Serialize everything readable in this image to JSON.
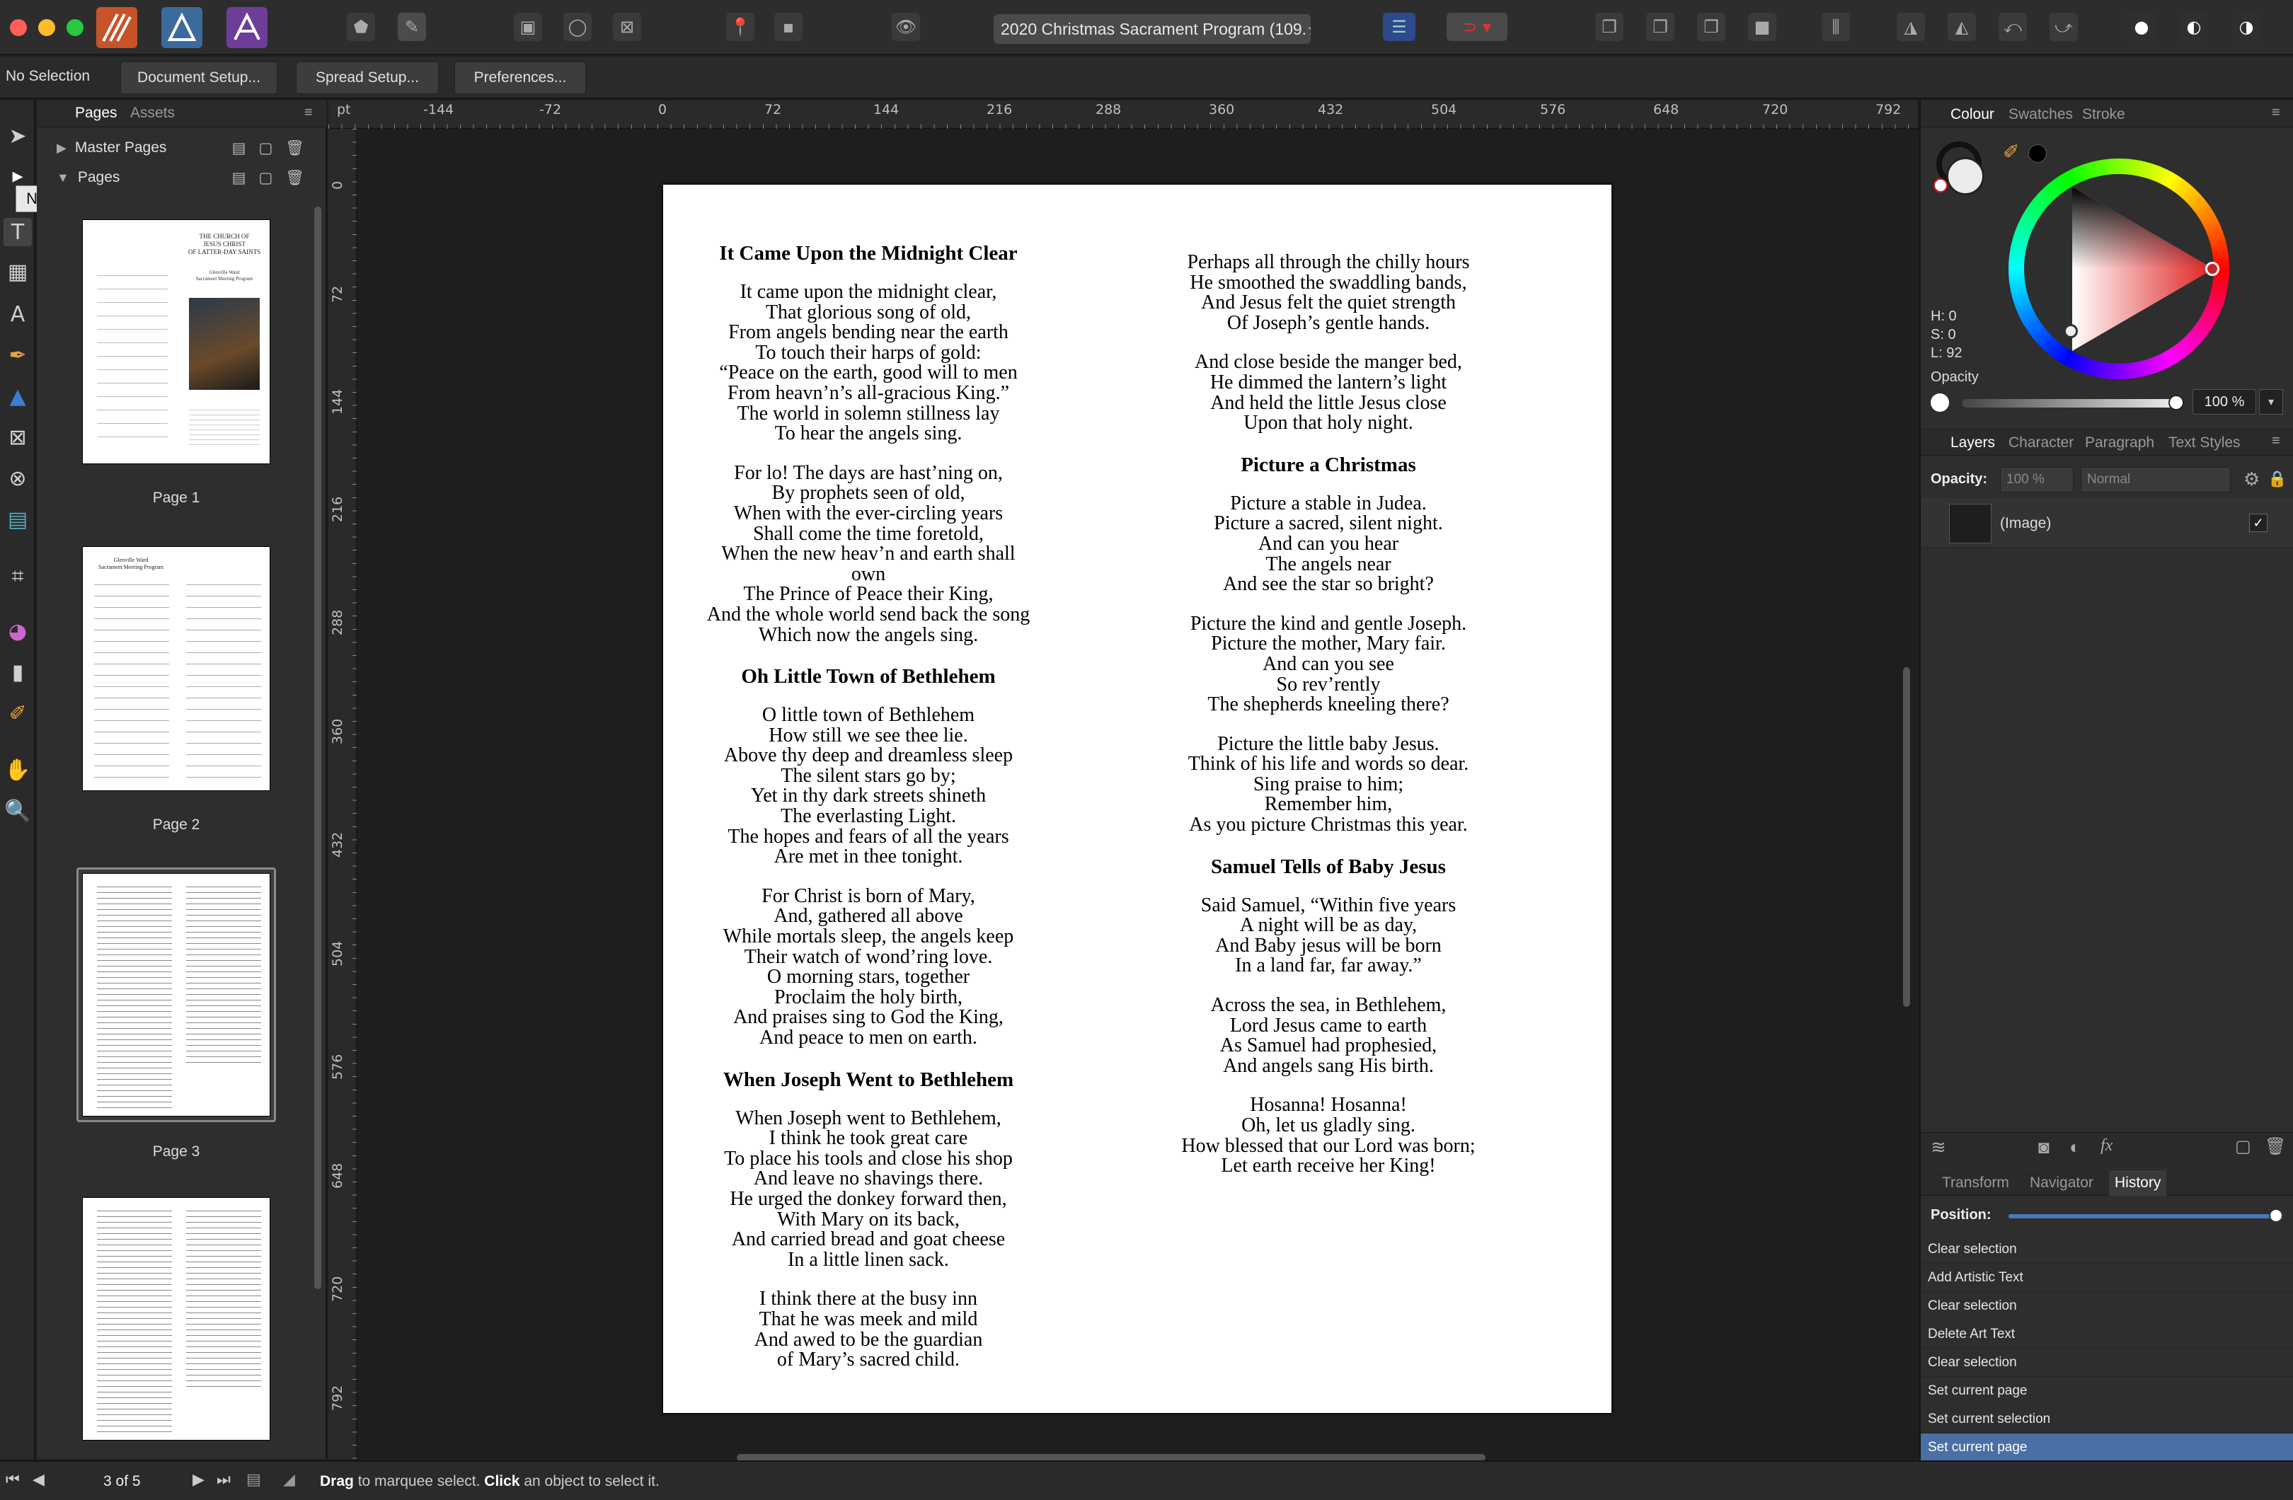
{
  "window": {
    "document_title": "2020 Christmas Sacrament Program (109.",
    "title_suffix_icon": "star-icon"
  },
  "context_bar": {
    "selection_label": "No Selection",
    "document_setup": "Document Setup...",
    "spread_setup": "Spread Setup...",
    "preferences": "Preferences..."
  },
  "tooltip": "Node Tool [A]",
  "left_panel": {
    "tabs": [
      "Pages",
      "Assets"
    ],
    "master_pages_label": "Master Pages",
    "pages_label": "Pages",
    "page_labels": [
      "Page 1",
      "Page 2",
      "Page 3"
    ],
    "thumb1_title": "THE CHURCH OF\nJESUS CHRIST\nOF LATTER-DAY SAINTS",
    "thumb1_sub": "Glenville Ward\nSacrament Meeting Program",
    "thumb2_title": "Glenville Ward\nSacrament Meeting Program"
  },
  "ruler": {
    "h_labels": [
      "pt",
      "-144",
      "-72",
      "0",
      "72",
      "144",
      "216",
      "288",
      "360",
      "432",
      "504",
      "576",
      "648",
      "720",
      "792"
    ],
    "v_labels": [
      "0",
      "72",
      "144",
      "216",
      "288",
      "360",
      "432",
      "504",
      "576",
      "648",
      "720",
      "792"
    ]
  },
  "document": {
    "left_column": [
      {
        "title": "It Came Upon the Midnight Clear",
        "verses": [
          "It came upon the midnight clear,\nThat glorious song of old,\nFrom angels bending near the earth\nTo touch their harps of gold:\n“Peace on the earth, good will to men\nFrom heavn’n’s all-gracious King.”\nThe world in solemn stillness lay\nTo hear the angels sing.",
          "For lo! The days are hast’ning on,\nBy prophets seen of old,\nWhen with the ever-circling years\nShall come the time foretold,\nWhen the new heav’n and earth shall own\nThe Prince of Peace their King,\nAnd the whole world send back the song\nWhich now the angels sing."
        ]
      },
      {
        "title": "Oh Little Town of Bethlehem",
        "verses": [
          "O little town of Bethlehem\nHow still we see thee lie.\nAbove thy deep and dreamless sleep\nThe silent stars go by;\nYet in thy dark streets shineth\nThe everlasting Light.\nThe hopes and fears of all the years\nAre met in thee tonight.",
          "For Christ is born of Mary,\nAnd, gathered all above\nWhile mortals sleep, the angels keep\nTheir watch of wond’ring love.\nO morning stars, together\nProclaim the holy birth,\nAnd praises sing to God the King,\nAnd peace to men on earth."
        ]
      },
      {
        "title": "When Joseph Went to Bethlehem",
        "verses": [
          "When Joseph went to Bethlehem,\nI think he took great care\nTo place his tools and close his shop\nAnd leave no shavings there.\nHe urged the donkey forward then,\nWith Mary on its back,\nAnd carried bread and goat cheese\nIn a little linen sack.",
          "I think there at the busy inn\nThat he was meek and mild\nAnd awed to be the guardian\nof Mary’s sacred child."
        ]
      }
    ],
    "right_column": [
      {
        "title": "",
        "verses": [
          "Perhaps all through the chilly hours\nHe smoothed the swaddling bands,\nAnd Jesus felt the quiet strength\nOf Joseph’s gentle hands.",
          "And close beside the manger bed,\nHe dimmed the lantern’s light\nAnd held the little Jesus close\nUpon that holy night."
        ]
      },
      {
        "title": "Picture a Christmas",
        "verses": [
          "Picture a stable in Judea.\nPicture a sacred, silent night.\nAnd can you hear\nThe angels near\nAnd see the star so bright?",
          "Picture the kind and gentle Joseph.\nPicture the mother, Mary fair.\nAnd can you see\nSo rev’rently\nThe shepherds kneeling there?",
          "Picture the little baby Jesus.\nThink of his life and words so dear.\nSing praise to him;\nRemember him,\nAs you picture Christmas this year."
        ]
      },
      {
        "title": "Samuel Tells of Baby Jesus",
        "verses": [
          "Said Samuel, “Within five years\nA night will be as day,\nAnd Baby jesus will be born\nIn a land far, far away.”",
          "Across the sea, in Bethlehem,\nLord Jesus came to earth\nAs Samuel had prophesied,\nAnd angels sang His birth.",
          "Hosanna! Hosanna!\nOh, let us gladly sing.\nHow blessed that our Lord was born;\nLet earth receive her King!"
        ]
      }
    ]
  },
  "right_panel": {
    "colour_tabs": [
      "Colour",
      "Swatches",
      "Stroke"
    ],
    "hsl": [
      "H: 0",
      "S: 0",
      "L: 92"
    ],
    "opacity_label": "Opacity",
    "opacity_value": "100 %",
    "layer_tabs": [
      "Layers",
      "Character",
      "Paragraph",
      "Text Styles"
    ],
    "layer_opacity_label": "Opacity:",
    "layer_opacity_value": "100 %",
    "blend_mode": "Normal",
    "layer_name": "(Image)",
    "bottom_tabs": [
      "Transform",
      "Navigator",
      "History"
    ],
    "position_label": "Position:",
    "position_value": 1.0,
    "history": [
      "Clear selection",
      "Add Artistic Text",
      "Clear selection",
      "Delete Art Text",
      "Clear selection",
      "Set current page",
      "Set current selection",
      "Set current page"
    ],
    "accent": "#4a6fa5",
    "wheel_marker": "#c0262b"
  },
  "status": {
    "page_counter": "3 of 5",
    "hint_drag": "Drag",
    "hint_mid": " to marquee select. ",
    "hint_click": "Click",
    "hint_end": " an object to select it."
  }
}
